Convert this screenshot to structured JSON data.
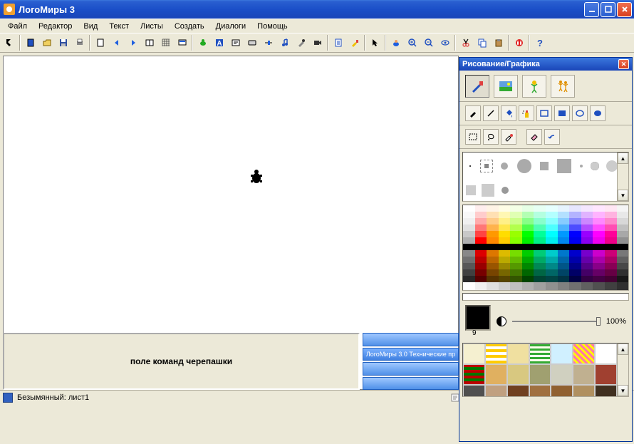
{
  "window": {
    "title": "ЛогоМиры 3"
  },
  "menu": {
    "items": [
      "Файл",
      "Редактор",
      "Вид",
      "Текст",
      "Листы",
      "Создать",
      "Диалоги",
      "Помощь"
    ]
  },
  "command_panel": {
    "label": "поле команд черепашки"
  },
  "side_panel": {
    "banner": "ЛогоМиры 3.0 Технические пр"
  },
  "status": {
    "document": "Безымянный: лист1"
  },
  "draw_panel": {
    "title": "Рисование/Графика",
    "slider_pct": "100%",
    "swatch_number": "9",
    "current_color": "#000000"
  },
  "palette_rows": [
    [
      "#ffffff",
      "#ffeeee",
      "#fff4e6",
      "#fffde6",
      "#f4ffe6",
      "#e6ffe6",
      "#e6fff4",
      "#e6ffff",
      "#e6f4ff",
      "#e6e6ff",
      "#f4e6ff",
      "#ffe6ff",
      "#ffe6f4",
      "#f5f5f5"
    ],
    [
      "#f8f8f8",
      "#ffcccc",
      "#ffe0b3",
      "#fff7b3",
      "#e0ffb3",
      "#b3ffb3",
      "#b3ffe0",
      "#b3ffff",
      "#b3e0ff",
      "#b3b3ff",
      "#e0b3ff",
      "#ffb3ff",
      "#ffb3e0",
      "#e8e8e8"
    ],
    [
      "#f0f0f0",
      "#ffaaaa",
      "#ffcc88",
      "#fff088",
      "#ccff88",
      "#88ff88",
      "#88ffcc",
      "#88ffff",
      "#88ccff",
      "#8888ff",
      "#cc88ff",
      "#ff88ff",
      "#ff88cc",
      "#d8d8d8"
    ],
    [
      "#e0e0e0",
      "#ff7777",
      "#ffb34d",
      "#ffe74d",
      "#b3ff4d",
      "#4dff4d",
      "#4dffb3",
      "#4dffff",
      "#4db3ff",
      "#4d4dff",
      "#b34dff",
      "#ff4dff",
      "#ff4db3",
      "#c0c0c0"
    ],
    [
      "#c8c8c8",
      "#ff4444",
      "#ff9900",
      "#ffdd00",
      "#99ff00",
      "#00ff00",
      "#00ff99",
      "#00ffff",
      "#0099ff",
      "#0000ff",
      "#9900ff",
      "#ff00ff",
      "#ff0099",
      "#a8a8a8"
    ],
    [
      "#b0b0b0",
      "#ff0000",
      "#ff8800",
      "#ffcc00",
      "#88ff00",
      "#00ee00",
      "#00ee88",
      "#00eeee",
      "#0088ee",
      "#0000ee",
      "#8800ee",
      "#ee00ee",
      "#ee0088",
      "#909090"
    ],
    [
      "#000000",
      "#000000",
      "#000000",
      "#000000",
      "#000000",
      "#000000",
      "#000000",
      "#000000",
      "#000000",
      "#000000",
      "#000000",
      "#000000",
      "#000000",
      "#000000"
    ],
    [
      "#888888",
      "#dd0000",
      "#dd7700",
      "#ddbb00",
      "#77dd00",
      "#00cc00",
      "#00cc77",
      "#00cccc",
      "#0077cc",
      "#0000cc",
      "#7700cc",
      "#cc00cc",
      "#cc0077",
      "#787878"
    ],
    [
      "#707070",
      "#bb0000",
      "#bb6600",
      "#bbaa00",
      "#66bb00",
      "#00aa00",
      "#00aa66",
      "#00aaaa",
      "#0066aa",
      "#0000aa",
      "#6600aa",
      "#aa00aa",
      "#aa0066",
      "#606060"
    ],
    [
      "#585858",
      "#990000",
      "#995500",
      "#998800",
      "#559900",
      "#008800",
      "#008855",
      "#008888",
      "#005588",
      "#000088",
      "#550088",
      "#880088",
      "#880055",
      "#484848"
    ],
    [
      "#404040",
      "#770000",
      "#774400",
      "#776600",
      "#447700",
      "#006600",
      "#006644",
      "#006666",
      "#004466",
      "#000066",
      "#440066",
      "#660066",
      "#660044",
      "#303030"
    ],
    [
      "#282828",
      "#550000",
      "#553300",
      "#554400",
      "#335500",
      "#004400",
      "#004433",
      "#004444",
      "#003344",
      "#000044",
      "#330044",
      "#440044",
      "#440033",
      "#181818"
    ]
  ],
  "gray_strip": [
    "#ffffff",
    "#f0f0f0",
    "#e0e0e0",
    "#d0d0d0",
    "#c0c0c0",
    "#b0b0b0",
    "#a0a0a0",
    "#909090",
    "#808080",
    "#707070",
    "#606060",
    "#505050",
    "#404040",
    "#303030"
  ],
  "patterns": [
    "#f5f0d0",
    "repeating-linear-gradient(0deg,#ffcc00 0 4px,#fff 4px 8px),repeating-linear-gradient(90deg,#ffcc00 0 4px,transparent 4px 8px)",
    "#f0e0a0",
    "repeating-linear-gradient(0deg,#3a3 0 3px,#ffe 3px 6px),repeating-linear-gradient(90deg,#3a3 0 3px,transparent 3px 6px)",
    "#d0f0ff",
    "repeating-linear-gradient(45deg,#f7a 0 3px,#ff0 3px 6px)",
    "#fff",
    "repeating-linear-gradient(0deg,#b00 0 4px,#070 4px 8px),repeating-linear-gradient(90deg,#b00 0 4px,transparent 4px 8px)",
    "#e0b060",
    "#d8c880",
    "#a0a070",
    "#d0d0c0",
    "#c0b090",
    "#a04030",
    "#505050",
    "#c0a080",
    "#704020",
    "#a07040",
    "#906030",
    "#b09060",
    "#403020"
  ]
}
